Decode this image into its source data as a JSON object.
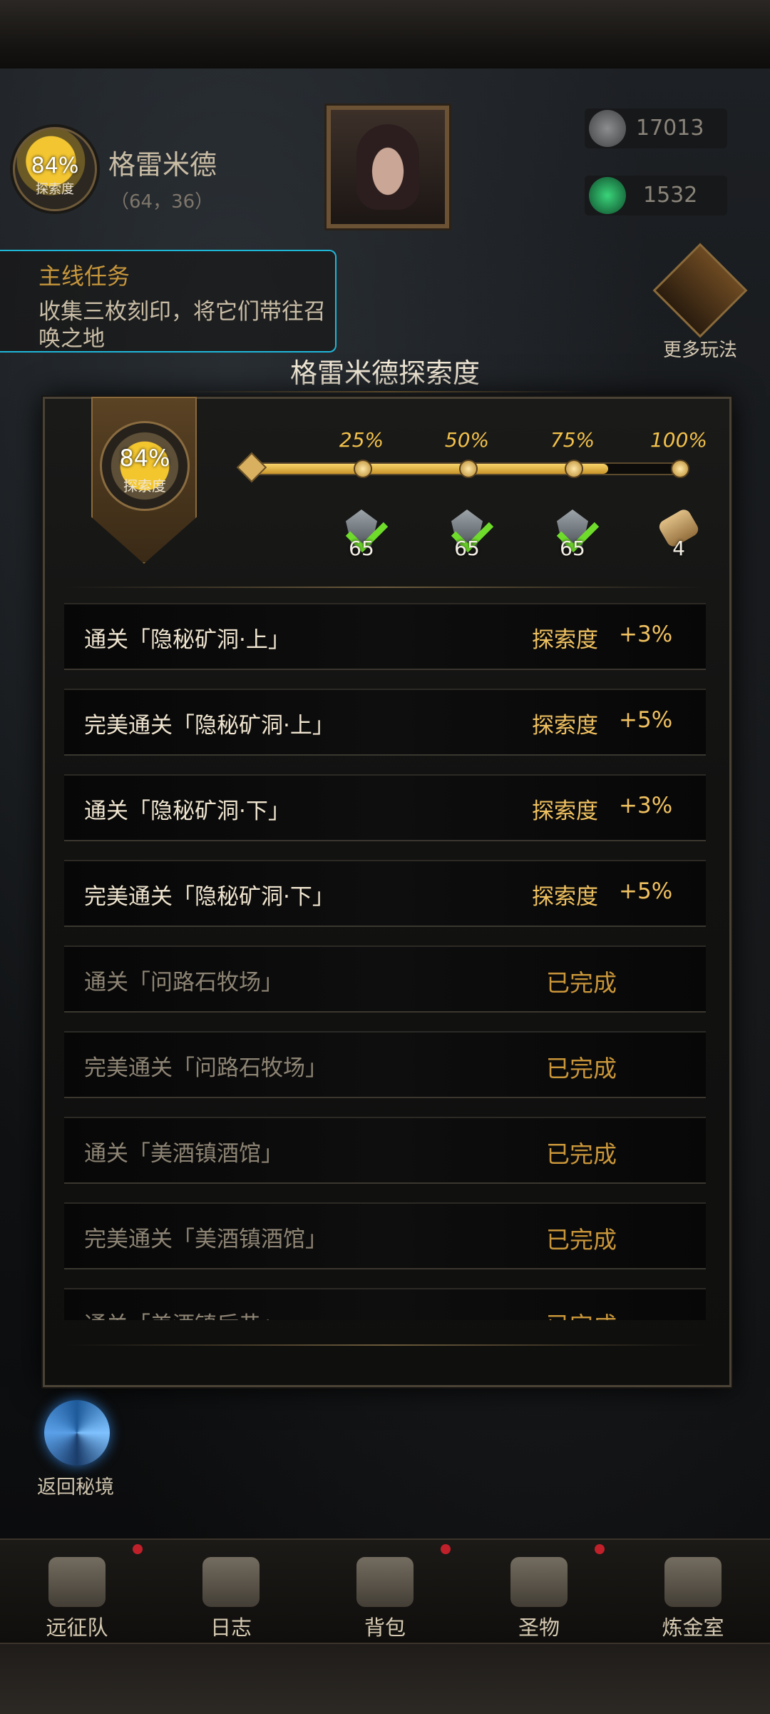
{
  "region": {
    "name": "格雷米德",
    "coords": "（64，36）",
    "exploration_pct": "84%",
    "exploration_label": "探索度"
  },
  "resources": [
    {
      "icon": "stone-icon",
      "value": "17013"
    },
    {
      "icon": "emerald-icon",
      "value": "1532"
    }
  ],
  "quest": {
    "title": "主线任务",
    "text": "收集三枚刻印，将它们带往召唤之地"
  },
  "side_button": {
    "label": "更多玩法"
  },
  "dialog": {
    "title": "格雷米德探索度",
    "progress": 0.84,
    "emblem_pct": "84%",
    "emblem_label": "探索度",
    "milestones": [
      {
        "label": "25%",
        "count": "65",
        "claimed": true,
        "icon": "gem-icon"
      },
      {
        "label": "50%",
        "count": "65",
        "claimed": true,
        "icon": "gem-icon"
      },
      {
        "label": "75%",
        "count": "65",
        "claimed": true,
        "icon": "gem-icon"
      },
      {
        "label": "100%",
        "count": "4",
        "claimed": false,
        "icon": "scroll-icon"
      }
    ],
    "tasks": [
      {
        "text": "通关「隐秘矿洞·上」",
        "reward_label": "探索度",
        "reward": "+3%",
        "done": false
      },
      {
        "text": "完美通关「隐秘矿洞·上」",
        "reward_label": "探索度",
        "reward": "+5%",
        "done": false
      },
      {
        "text": "通关「隐秘矿洞·下」",
        "reward_label": "探索度",
        "reward": "+3%",
        "done": false
      },
      {
        "text": "完美通关「隐秘矿洞·下」",
        "reward_label": "探索度",
        "reward": "+5%",
        "done": false
      },
      {
        "text": "通关「问路石牧场」",
        "status": "已完成",
        "done": true
      },
      {
        "text": "完美通关「问路石牧场」",
        "status": "已完成",
        "done": true
      },
      {
        "text": "通关「美酒镇酒馆」",
        "status": "已完成",
        "done": true
      },
      {
        "text": "完美通关「美酒镇酒馆」",
        "status": "已完成",
        "done": true
      },
      {
        "text": "通关「美酒镇后巷」",
        "status": "已完成",
        "done": true
      }
    ]
  },
  "portal": {
    "label": "返回秘境"
  },
  "nav": [
    {
      "label": "远征队",
      "icon": "helmet-icon",
      "badge": true
    },
    {
      "label": "日志",
      "icon": "journal-icon",
      "badge": false
    },
    {
      "label": "背包",
      "icon": "backpack-icon",
      "badge": true
    },
    {
      "label": "圣物",
      "icon": "chalice-icon",
      "badge": true
    },
    {
      "label": "炼金室",
      "icon": "alchemy-icon",
      "badge": false
    }
  ]
}
